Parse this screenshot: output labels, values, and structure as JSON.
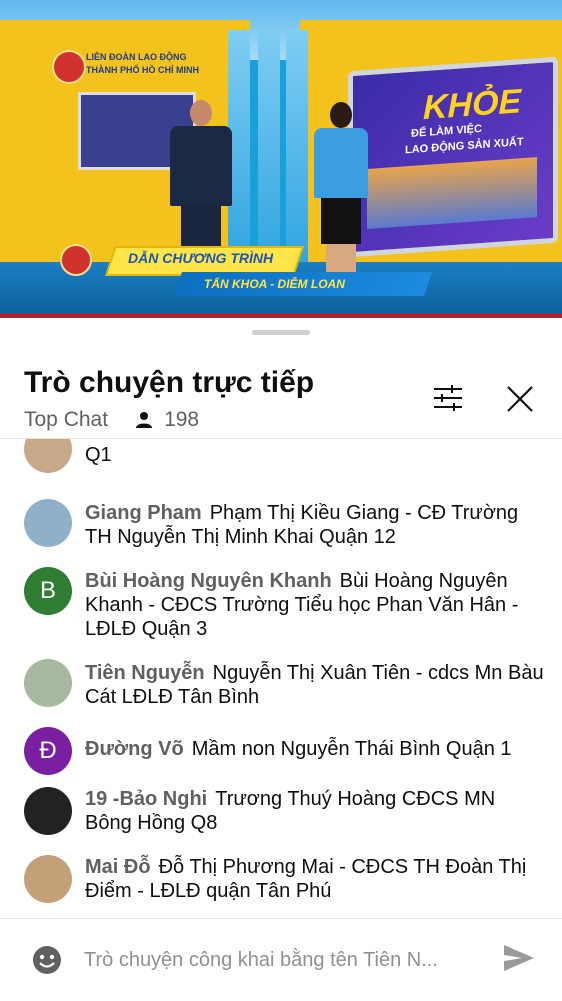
{
  "video": {
    "org_line1": "LIÊN ĐOÀN LAO ĐỘNG",
    "org_line2": "THÀNH PHỐ HỒ CHÍ MINH",
    "screen_title": "KHỎE",
    "screen_sub1": "ĐỂ LÀM VIỆC",
    "screen_sub2": "LAO ĐỘNG SẢN XUẤT",
    "banner_label": "DẪN CHƯƠNG TRÌNH",
    "banner_names": "TẤN KHOA - DIỄM LOAN",
    "progress": 1.0
  },
  "chat": {
    "title": "Trò chuyện trực tiếp",
    "mode": "Top Chat",
    "viewer_count": "198",
    "icons": {
      "filter": "tune-icon",
      "close": "close-icon",
      "viewers": "person-icon",
      "emoji": "emoji-icon",
      "send": "send-icon"
    }
  },
  "messages": [
    {
      "author": "",
      "text": "Q1",
      "avatar_letter": "",
      "avatar_color": "#c9a88a"
    },
    {
      "author": "Giang Pham",
      "text": "Phạm Thị Kiều Giang - CĐ Trường TH Nguyễn Thị Minh Khai Quận 12",
      "avatar_letter": "",
      "avatar_color": "#8fb0c6"
    },
    {
      "author": "Bùi Hoàng Nguyên Khanh",
      "text": "Bùi Hoàng Nguyên Khanh - CĐCS Trường Tiểu học Phan Văn Hân - LĐLĐ Quận 3",
      "avatar_letter": "B",
      "avatar_color": "#2e7d32"
    },
    {
      "author": "Tiên Nguyễn",
      "text": "Nguyễn Thị Xuân Tiên - cdcs Mn Bàu Cát LĐLĐ Tân Bình",
      "avatar_letter": "",
      "avatar_color": "#a8b8a0"
    },
    {
      "author": "Đường Võ",
      "text": "Mầm non Nguyễn Thái Bình Quận 1",
      "avatar_letter": "Đ",
      "avatar_color": "#7b1fa2"
    },
    {
      "author": "19 -Bảo Nghi",
      "text": "Trương Thuý Hoàng CĐCS MN Bông Hồng Q8",
      "avatar_letter": "",
      "avatar_color": "#222222"
    },
    {
      "author": "Mai Đỗ",
      "text": "Đỗ Thị Phương Mai - CĐCS TH Đoàn Thị Điểm - LĐLĐ quận Tân Phú",
      "avatar_letter": "",
      "avatar_color": "#c4a078"
    }
  ],
  "input": {
    "placeholder": "Trò chuyện công khai bằng tên Tiên N..."
  }
}
